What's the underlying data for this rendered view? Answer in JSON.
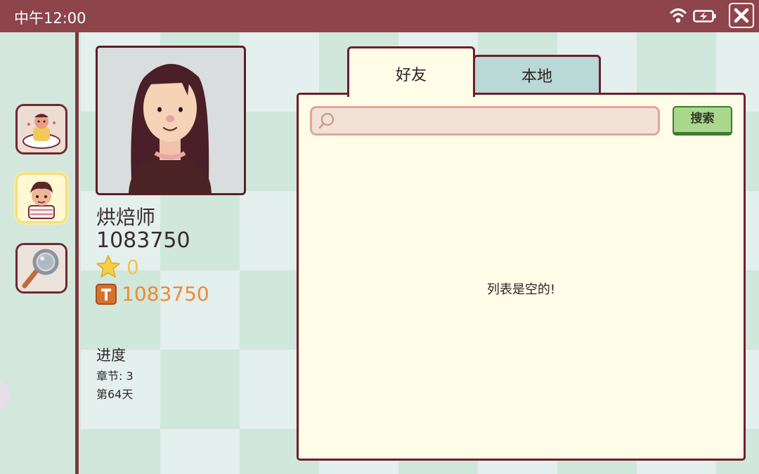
{
  "status_bar": {
    "time": "中午12:00"
  },
  "icons": {
    "wifi": "wifi-icon",
    "battery": "battery-charging-icon",
    "close": "close-icon",
    "search": "search-icon",
    "star": "star-icon",
    "coin": "coin-icon"
  },
  "profile": {
    "name": "烘焙师",
    "id": "1083750",
    "stars": "0",
    "coins": "1083750",
    "progress_title": "进度",
    "chapter": "章节: 3",
    "day": "第64天"
  },
  "tabs": [
    {
      "label": "好友",
      "selected": true
    },
    {
      "label": "本地",
      "selected": false
    }
  ],
  "search": {
    "value": "",
    "placeholder": "",
    "button_label": "搜索"
  },
  "list": {
    "empty_message": "列表是空的!"
  },
  "colors": {
    "top_bar": "#8e444b",
    "panel": "#fffde8",
    "border": "#6e1d2f",
    "star_count": "#efc749",
    "coin_count": "#ef8a36",
    "search_button": "#a9d88b"
  }
}
